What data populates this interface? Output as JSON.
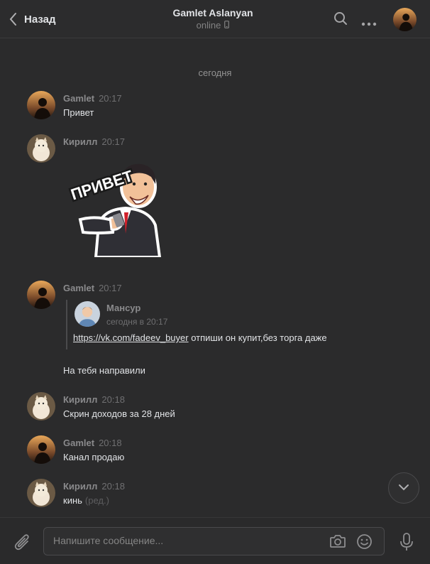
{
  "header": {
    "back_label": "Назад",
    "title": "Gamlet Aslanyan",
    "status": "online"
  },
  "date_separator": "сегодня",
  "messages": [
    {
      "author": "Gamlet",
      "time": "20:17",
      "text": "Привет"
    },
    {
      "author": "Кирилл",
      "time": "20:17",
      "sticker_text": "ПРИВЕТ"
    },
    {
      "author": "Gamlet",
      "time": "20:17",
      "reply": {
        "author": "Мансур",
        "time": "сегодня в 20:17",
        "link": "https://vk.com/fadeev_buyer",
        "text": " отпиши он купит,без торга даже"
      },
      "text": "На тебя направили"
    },
    {
      "author": "Кирилл",
      "time": "20:18",
      "text": "Скрин доходов за 28 дней"
    },
    {
      "author": "Gamlet",
      "time": "20:18",
      "text": "Канал продаю"
    },
    {
      "author": "Кирилл",
      "time": "20:18",
      "text": "кинь",
      "edited": "(ред.)"
    }
  ],
  "composer": {
    "placeholder": "Напишите сообщение..."
  },
  "colors": {
    "background": "#2b2b2c",
    "text": "#e1e3e6",
    "muted": "#828282"
  }
}
